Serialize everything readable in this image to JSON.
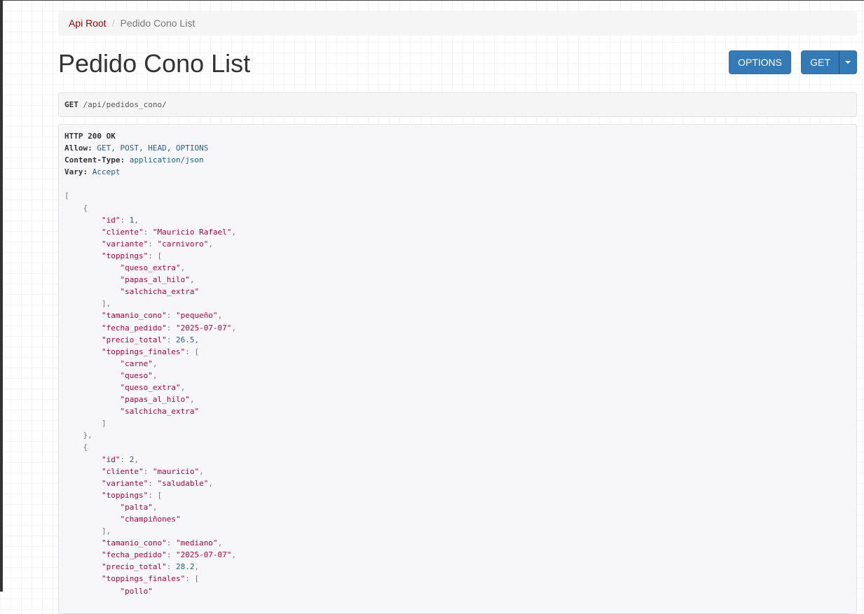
{
  "breadcrumb": {
    "root_label": "Api Root",
    "separator": "/",
    "current_label": "Pedido Cono List"
  },
  "page": {
    "title": "Pedido Cono List"
  },
  "buttons": {
    "options_label": "OPTIONS",
    "get_label": "GET"
  },
  "request": {
    "method": "GET",
    "url": "/api/pedidos_cono/"
  },
  "response": {
    "status": "HTTP 200 OK",
    "headers": [
      {
        "name": "Allow:",
        "value": "GET, POST, HEAD, OPTIONS"
      },
      {
        "name": "Content-Type:",
        "value": "application/json"
      },
      {
        "name": "Vary:",
        "value": "Accept"
      }
    ],
    "body_lines": [
      [
        {
          "t": "[",
          "c": "pun"
        }
      ],
      [
        {
          "t": "    {",
          "c": "pun"
        }
      ],
      [
        {
          "t": "        "
        },
        {
          "t": "\"id\"",
          "c": "key"
        },
        {
          "t": ": ",
          "c": "pun"
        },
        {
          "t": "1",
          "c": "num"
        },
        {
          "t": ",",
          "c": "pun"
        }
      ],
      [
        {
          "t": "        "
        },
        {
          "t": "\"cliente\"",
          "c": "key"
        },
        {
          "t": ": ",
          "c": "pun"
        },
        {
          "t": "\"Mauricio Rafael\"",
          "c": "str"
        },
        {
          "t": ",",
          "c": "pun"
        }
      ],
      [
        {
          "t": "        "
        },
        {
          "t": "\"variante\"",
          "c": "key"
        },
        {
          "t": ": ",
          "c": "pun"
        },
        {
          "t": "\"carnivoro\"",
          "c": "str"
        },
        {
          "t": ",",
          "c": "pun"
        }
      ],
      [
        {
          "t": "        "
        },
        {
          "t": "\"toppings\"",
          "c": "key"
        },
        {
          "t": ": [",
          "c": "pun"
        }
      ],
      [
        {
          "t": "            "
        },
        {
          "t": "\"queso_extra\"",
          "c": "str"
        },
        {
          "t": ",",
          "c": "pun"
        }
      ],
      [
        {
          "t": "            "
        },
        {
          "t": "\"papas_al_hilo\"",
          "c": "str"
        },
        {
          "t": ",",
          "c": "pun"
        }
      ],
      [
        {
          "t": "            "
        },
        {
          "t": "\"salchicha_extra\"",
          "c": "str"
        }
      ],
      [
        {
          "t": "        ],",
          "c": "pun"
        }
      ],
      [
        {
          "t": "        "
        },
        {
          "t": "\"tamanio_cono\"",
          "c": "key"
        },
        {
          "t": ": ",
          "c": "pun"
        },
        {
          "t": "\"pequeño\"",
          "c": "str"
        },
        {
          "t": ",",
          "c": "pun"
        }
      ],
      [
        {
          "t": "        "
        },
        {
          "t": "\"fecha_pedido\"",
          "c": "key"
        },
        {
          "t": ": ",
          "c": "pun"
        },
        {
          "t": "\"2025-07-07\"",
          "c": "str"
        },
        {
          "t": ",",
          "c": "pun"
        }
      ],
      [
        {
          "t": "        "
        },
        {
          "t": "\"precio_total\"",
          "c": "key"
        },
        {
          "t": ": ",
          "c": "pun"
        },
        {
          "t": "26.5",
          "c": "num"
        },
        {
          "t": ",",
          "c": "pun"
        }
      ],
      [
        {
          "t": "        "
        },
        {
          "t": "\"toppings_finales\"",
          "c": "key"
        },
        {
          "t": ": [",
          "c": "pun"
        }
      ],
      [
        {
          "t": "            "
        },
        {
          "t": "\"carne\"",
          "c": "str"
        },
        {
          "t": ",",
          "c": "pun"
        }
      ],
      [
        {
          "t": "            "
        },
        {
          "t": "\"queso\"",
          "c": "str"
        },
        {
          "t": ",",
          "c": "pun"
        }
      ],
      [
        {
          "t": "            "
        },
        {
          "t": "\"queso_extra\"",
          "c": "str"
        },
        {
          "t": ",",
          "c": "pun"
        }
      ],
      [
        {
          "t": "            "
        },
        {
          "t": "\"papas_al_hilo\"",
          "c": "str"
        },
        {
          "t": ",",
          "c": "pun"
        }
      ],
      [
        {
          "t": "            "
        },
        {
          "t": "\"salchicha_extra\"",
          "c": "str"
        }
      ],
      [
        {
          "t": "        ]",
          "c": "pun"
        }
      ],
      [
        {
          "t": "    },",
          "c": "pun"
        }
      ],
      [
        {
          "t": "    {",
          "c": "pun"
        }
      ],
      [
        {
          "t": "        "
        },
        {
          "t": "\"id\"",
          "c": "key"
        },
        {
          "t": ": ",
          "c": "pun"
        },
        {
          "t": "2",
          "c": "num"
        },
        {
          "t": ",",
          "c": "pun"
        }
      ],
      [
        {
          "t": "        "
        },
        {
          "t": "\"cliente\"",
          "c": "key"
        },
        {
          "t": ": ",
          "c": "pun"
        },
        {
          "t": "\"mauricio\"",
          "c": "str"
        },
        {
          "t": ",",
          "c": "pun"
        }
      ],
      [
        {
          "t": "        "
        },
        {
          "t": "\"variante\"",
          "c": "key"
        },
        {
          "t": ": ",
          "c": "pun"
        },
        {
          "t": "\"saludable\"",
          "c": "str"
        },
        {
          "t": ",",
          "c": "pun"
        }
      ],
      [
        {
          "t": "        "
        },
        {
          "t": "\"toppings\"",
          "c": "key"
        },
        {
          "t": ": [",
          "c": "pun"
        }
      ],
      [
        {
          "t": "            "
        },
        {
          "t": "\"palta\"",
          "c": "str"
        },
        {
          "t": ",",
          "c": "pun"
        }
      ],
      [
        {
          "t": "            "
        },
        {
          "t": "\"champiñones\"",
          "c": "str"
        }
      ],
      [
        {
          "t": "        ],",
          "c": "pun"
        }
      ],
      [
        {
          "t": "        "
        },
        {
          "t": "\"tamanio_cono\"",
          "c": "key"
        },
        {
          "t": ": ",
          "c": "pun"
        },
        {
          "t": "\"mediano\"",
          "c": "str"
        },
        {
          "t": ",",
          "c": "pun"
        }
      ],
      [
        {
          "t": "        "
        },
        {
          "t": "\"fecha_pedido\"",
          "c": "key"
        },
        {
          "t": ": ",
          "c": "pun"
        },
        {
          "t": "\"2025-07-07\"",
          "c": "str"
        },
        {
          "t": ",",
          "c": "pun"
        }
      ],
      [
        {
          "t": "        "
        },
        {
          "t": "\"precio_total\"",
          "c": "key"
        },
        {
          "t": ": ",
          "c": "pun"
        },
        {
          "t": "28.2",
          "c": "num"
        },
        {
          "t": ",",
          "c": "pun"
        }
      ],
      [
        {
          "t": "        "
        },
        {
          "t": "\"toppings_finales\"",
          "c": "key"
        },
        {
          "t": ": [",
          "c": "pun"
        }
      ],
      [
        {
          "t": "            "
        },
        {
          "t": "\"pollo\"",
          "c": "str"
        }
      ]
    ]
  },
  "colors": {
    "primary_button": "#337ab7",
    "breadcrumb_link": "#8b0000",
    "json_string": "#b0003a",
    "json_number": "#1f5f8b"
  }
}
